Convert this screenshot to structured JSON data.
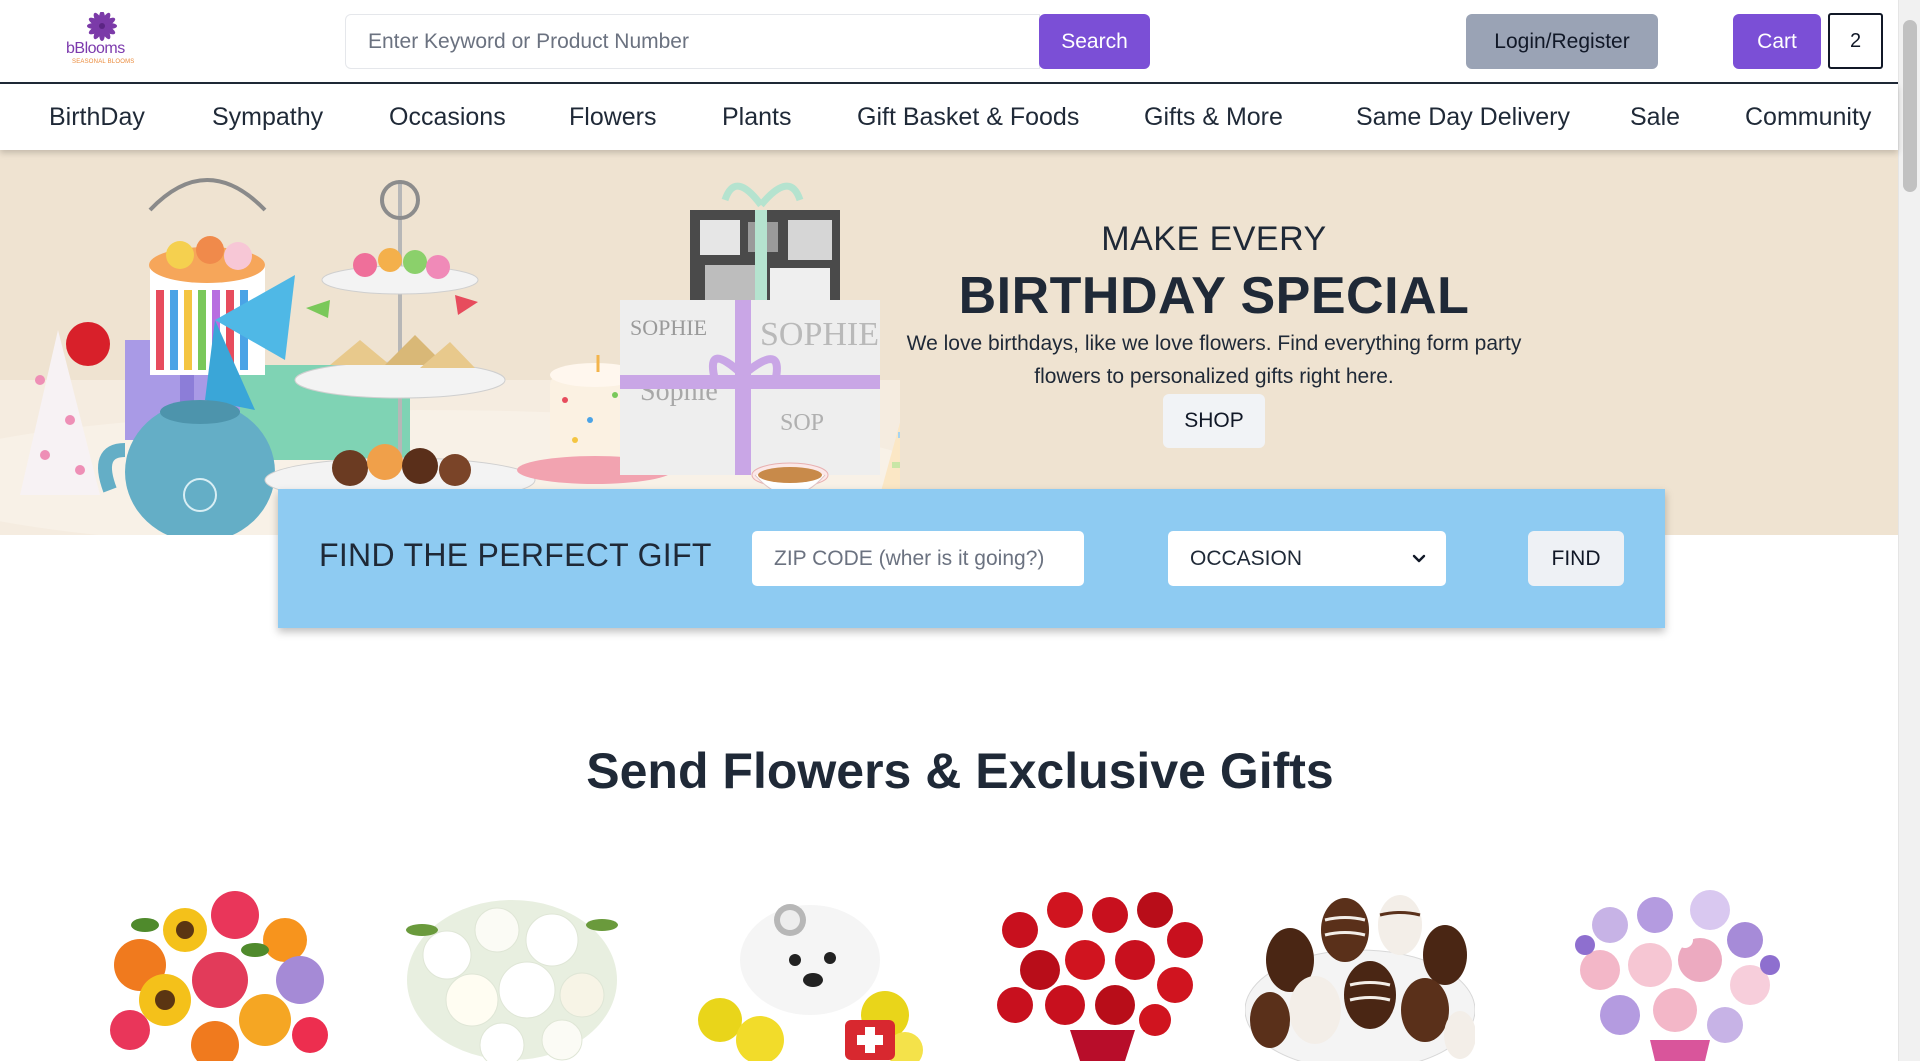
{
  "brand": {
    "name": "bBlooms",
    "tagline": "SEASONAL BLOOMS",
    "color": "#7b4fd6"
  },
  "header": {
    "search_placeholder": "Enter Keyword or Product Number",
    "search_label": "Search",
    "login_label": "Login/Register",
    "cart_label": "Cart",
    "cart_count": "2"
  },
  "nav": {
    "items": [
      {
        "label": "BirthDay"
      },
      {
        "label": "Sympathy"
      },
      {
        "label": "Occasions"
      },
      {
        "label": "Flowers"
      },
      {
        "label": "Plants"
      },
      {
        "label": "Gift Basket & Foods"
      },
      {
        "label": "Gifts & More"
      },
      {
        "label": "Same Day Delivery"
      },
      {
        "label": "Sale"
      },
      {
        "label": "Community"
      }
    ]
  },
  "hero": {
    "eyebrow": "MAKE EVERY",
    "title": "BIRTHDAY SPECIAL",
    "description": "We love birthdays, like we love flowers. Find everything form party flowers to personalized gifts right here.",
    "cta_label": "SHOP",
    "background_color": "#efe3d1"
  },
  "finder": {
    "title": "FIND THE PERFECT GIFT",
    "zip_placeholder": "ZIP CODE (wher is it going?)",
    "occasion_selected": "OCCASION",
    "find_label": "FIND",
    "background_color": "#8ecbf2"
  },
  "section": {
    "title": "Send Flowers & Exclusive Gifts",
    "products": [
      {
        "icon": "mixed-bouquet-icon"
      },
      {
        "icon": "white-lily-bouquet-icon"
      },
      {
        "icon": "puppy-flower-arrangement-icon"
      },
      {
        "icon": "red-roses-icon"
      },
      {
        "icon": "chocolate-strawberries-icon"
      },
      {
        "icon": "pastel-bouquet-icon"
      }
    ]
  }
}
